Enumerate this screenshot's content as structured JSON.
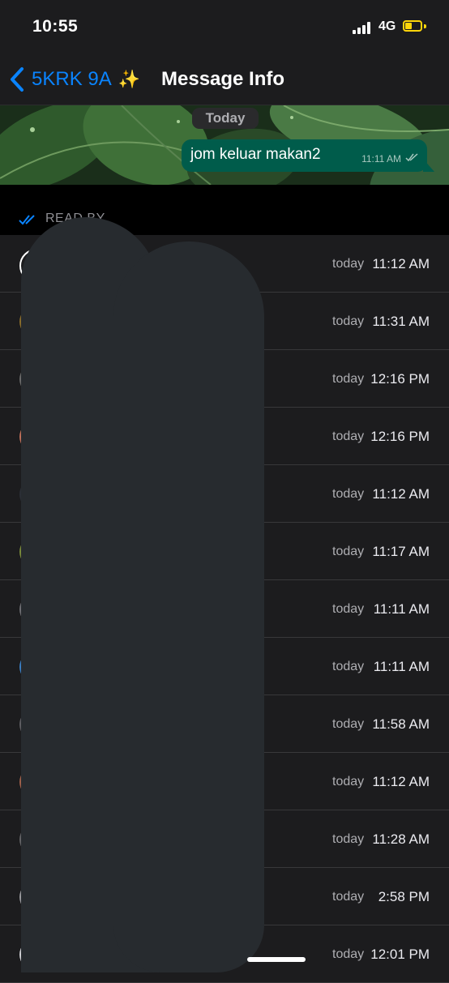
{
  "status": {
    "time": "10:55",
    "network": "4G",
    "battery_color": "#ffd60a",
    "icons": [
      "signal-icon",
      "battery-charging-icon"
    ]
  },
  "nav": {
    "back_label": "5KRK 9A",
    "back_emoji": "✨",
    "title": "Message Info"
  },
  "message": {
    "date_chip": "Today",
    "text": "jom keluar makan2",
    "time": "11:11 AM"
  },
  "read_by": {
    "label": "READ BY",
    "rows": [
      {
        "day": "today",
        "time": "11:12 AM",
        "avatar_color": "#1c1c1e"
      },
      {
        "day": "today",
        "time": "11:31 AM",
        "avatar_color": "#8a6d2b"
      },
      {
        "day": "today",
        "time": "12:16 PM",
        "avatar_color": "#6b6b6b"
      },
      {
        "day": "today",
        "time": "12:16 PM",
        "avatar_color": "#c0705a"
      },
      {
        "day": "today",
        "time": "11:12 AM",
        "avatar_color": "#2b2f36"
      },
      {
        "day": "today",
        "time": "11:17 AM",
        "avatar_color": "#7a8a3a"
      },
      {
        "day": "today",
        "time": "11:11 AM",
        "avatar_color": "#6e6e73"
      },
      {
        "day": "today",
        "time": "11:11 AM",
        "avatar_color": "#3b7fc4"
      },
      {
        "day": "today",
        "time": "11:58 AM",
        "avatar_color": "#5e5e63"
      },
      {
        "day": "today",
        "time": "11:12 AM",
        "avatar_color": "#a0604a"
      },
      {
        "day": "today",
        "time": "11:28 AM",
        "avatar_color": "#636366"
      },
      {
        "day": "today",
        "time": "2:58 PM",
        "avatar_color": "#9a9a9e"
      },
      {
        "day": "today",
        "time": "12:01 PM",
        "avatar_color": "#d0d0d4"
      }
    ]
  },
  "colors": {
    "accent": "#0a84ff",
    "bubble": "#005c4b",
    "redaction": "#272b2f"
  }
}
